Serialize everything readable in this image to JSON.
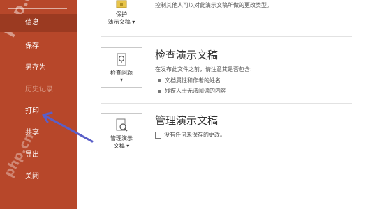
{
  "sidebar": {
    "items": [
      {
        "label": "信息",
        "state": "active"
      },
      {
        "label": "保存",
        "state": "normal"
      },
      {
        "label": "另存为",
        "state": "normal"
      },
      {
        "label": "历史记录",
        "state": "disabled"
      },
      {
        "label": "打印",
        "state": "normal"
      },
      {
        "label": "共享",
        "state": "normal"
      },
      {
        "label": "导出",
        "state": "normal"
      },
      {
        "label": "关闭",
        "state": "normal"
      }
    ],
    "watermark": "php.cn"
  },
  "protect": {
    "button_line1": "保护",
    "button_line2": "演示文稿",
    "desc": "控制其他人可以对此演示文稿所做的更改类型。"
  },
  "inspect": {
    "title": "检查演示文稿",
    "button_label": "检查问题",
    "desc": "在发布此文件之前，请注意其是否包含:",
    "bullets": [
      "文档属性和作者的姓名",
      "残疾人士无法阅读的内容"
    ]
  },
  "manage": {
    "title": "管理演示文稿",
    "button_line1": "管理演示",
    "button_line2": "文稿",
    "desc": "没有任何未保存的更改。"
  },
  "colors": {
    "sidebar_bg": "#b7472a",
    "sidebar_active": "#9b3a21",
    "annotation_arrow": "#5a5fc8"
  }
}
